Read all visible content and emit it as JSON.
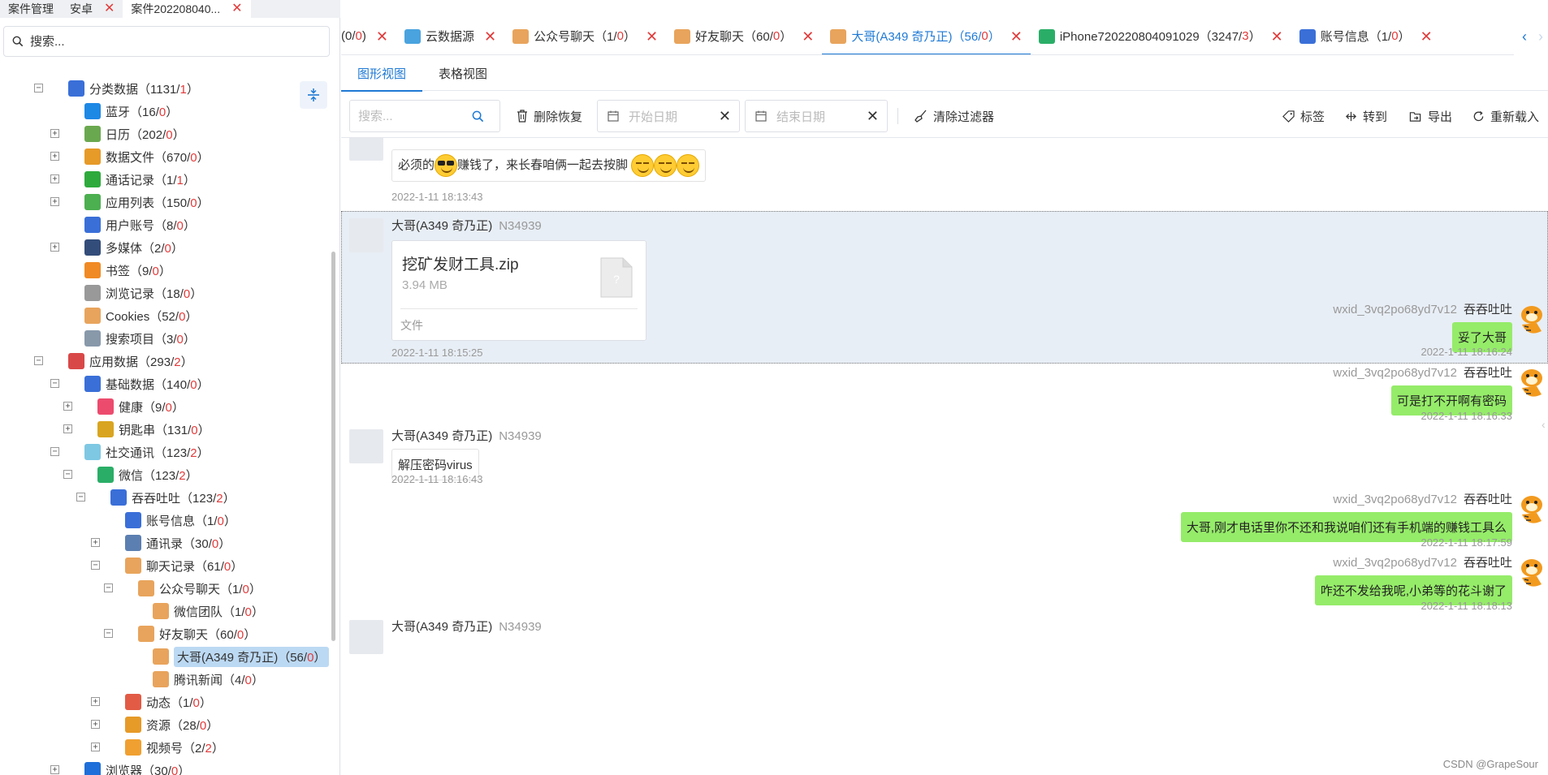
{
  "left_tabs": [
    {
      "label": "案件管理",
      "active": false
    },
    {
      "label": "安卓",
      "active": false
    },
    {
      "label": "案件202208040...",
      "active": true
    }
  ],
  "search": {
    "placeholder": "搜索..."
  },
  "tree": [
    {
      "label": "分类数据",
      "total": "1131",
      "red": "1",
      "icon": "classified-data-icon",
      "color": "#3a6fd8"
    },
    {
      "label": "蓝牙",
      "total": "16",
      "red": "0",
      "icon": "bluetooth-icon",
      "color": "#1e88e5"
    },
    {
      "label": "日历",
      "total": "202",
      "red": "0",
      "icon": "calendar-icon",
      "color": "#6aa84f"
    },
    {
      "label": "数据文件",
      "total": "670",
      "red": "0",
      "icon": "data-files-icon",
      "color": "#e69a28"
    },
    {
      "label": "通话记录",
      "total": "1",
      "red": "1",
      "icon": "phone-icon",
      "color": "#2eaa3c"
    },
    {
      "label": "应用列表",
      "total": "150",
      "red": "0",
      "icon": "app-list-icon",
      "color": "#4caf50"
    },
    {
      "label": "用户账号",
      "total": "8",
      "red": "0",
      "icon": "user-account-icon",
      "color": "#3a6fd8"
    },
    {
      "label": "多媒体",
      "total": "2",
      "red": "0",
      "icon": "multimedia-icon",
      "color": "#334d7a"
    },
    {
      "label": "书签",
      "total": "9",
      "red": "0",
      "icon": "bookmark-icon",
      "color": "#f08a24"
    },
    {
      "label": "浏览记录",
      "total": "18",
      "red": "0",
      "icon": "browse-history-icon",
      "color": "#999999"
    },
    {
      "label": "Cookies",
      "total": "52",
      "red": "0",
      "icon": "cookies-icon",
      "color": "#e8a45c"
    },
    {
      "label": "搜索项目",
      "total": "3",
      "red": "0",
      "icon": "search-items-icon",
      "color": "#8899aa"
    },
    {
      "label": "应用数据",
      "total": "293",
      "red": "2",
      "icon": "app-data-icon",
      "color": "#d94848"
    },
    {
      "label": "基础数据",
      "total": "140",
      "red": "0",
      "icon": "basic-data-icon",
      "color": "#3a6fd8"
    },
    {
      "label": "健康",
      "total": "9",
      "red": "0",
      "icon": "health-heart-icon",
      "color": "#ec4b6e"
    },
    {
      "label": "钥匙串",
      "total": "131",
      "red": "0",
      "icon": "keychain-icon",
      "color": "#d9a520"
    },
    {
      "label": "社交通讯",
      "total": "123",
      "red": "2",
      "icon": "social-comm-icon",
      "color": "#7ec8e3"
    },
    {
      "label": "微信",
      "total": "123",
      "red": "2",
      "icon": "wechat-icon",
      "color": "#2aae67"
    },
    {
      "label": "吞吞吐吐",
      "total": "123",
      "red": "2",
      "icon": "user-profile-icon",
      "color": "#3a6fd8"
    },
    {
      "label": "账号信息",
      "total": "1",
      "red": "0",
      "icon": "account-info-icon",
      "color": "#3a6fd8"
    },
    {
      "label": "通讯录",
      "total": "30",
      "red": "0",
      "icon": "contacts-icon",
      "color": "#5b7fb0"
    },
    {
      "label": "聊天记录",
      "total": "61",
      "red": "0",
      "icon": "chat-history-icon",
      "color": "#e8a45c"
    },
    {
      "label": "公众号聊天",
      "total": "1",
      "red": "0",
      "icon": "chat-bubble-icon",
      "color": "#e8a45c"
    },
    {
      "label": "微信团队",
      "total": "1",
      "red": "0",
      "icon": "chat-bubble-icon",
      "color": "#e8a45c"
    },
    {
      "label": "好友聊天",
      "total": "60",
      "red": "0",
      "icon": "chat-bubble-icon",
      "color": "#e8a45c"
    },
    {
      "label": "大哥(A349 奇乃正)",
      "total": "56",
      "red": "0",
      "icon": "chat-bubble-icon",
      "color": "#e8a45c"
    },
    {
      "label": "腾讯新闻",
      "total": "4",
      "red": "0",
      "icon": "chat-bubble-icon",
      "color": "#e8a45c"
    },
    {
      "label": "动态",
      "total": "1",
      "red": "0",
      "icon": "moments-icon",
      "color": "#e25b45"
    },
    {
      "label": "资源",
      "total": "28",
      "red": "0",
      "icon": "resources-icon",
      "color": "#e69a28"
    },
    {
      "label": "视频号",
      "total": "2",
      "red": "2",
      "icon": "video-channel-icon",
      "color": "#f0a030"
    },
    {
      "label": "浏览器",
      "total": "30",
      "red": "0",
      "icon": "browser-ie-icon",
      "color": "#1e6fd9"
    }
  ],
  "right_tabs": [
    {
      "label": "(0/",
      "red": "0",
      "tail": ")",
      "icon": "",
      "active": false
    },
    {
      "label": "云数据源",
      "red": "",
      "tail": "",
      "icon": "cloud-icon",
      "active": false
    },
    {
      "label": "公众号聊天（1/",
      "red": "0",
      "tail": "）",
      "icon": "chat-bubble-icon",
      "active": false
    },
    {
      "label": "好友聊天（60/",
      "red": "0",
      "tail": "）",
      "icon": "chat-bubble-icon",
      "active": false
    },
    {
      "label": "大哥(A349 奇乃正)（56/",
      "red": "0",
      "tail": "）",
      "icon": "chat-bubble-icon",
      "active": true
    },
    {
      "label": "iPhone720220804091029（3247/",
      "red": "3",
      "tail": "）",
      "icon": "phone-device-icon",
      "active": false
    },
    {
      "label": "账号信息（1/",
      "red": "0",
      "tail": "）",
      "icon": "account-info-icon",
      "active": false
    }
  ],
  "view_tabs": {
    "graphic": "图形视图",
    "table": "表格视图"
  },
  "toolbar": {
    "search_placeholder": "搜索...",
    "delete_restore": "删除恢复",
    "start_date": "开始日期",
    "end_date": "结束日期",
    "clear_filter": "清除过滤器",
    "tag": "标签",
    "goto": "转到",
    "export": "导出",
    "reload": "重新载入"
  },
  "messages": {
    "m1": {
      "text": "必须的",
      "text2": "赚钱了，来长春咱俩一起去按脚",
      "time": "2022-1-11 18:13:43"
    },
    "m2": {
      "name": "大哥(A349 奇乃正)",
      "id": "N34939",
      "file_name": "挖矿发财工具.zip",
      "file_size": "3.94 MB",
      "file_type": "文件",
      "time": "2022-1-11 18:15:25"
    },
    "m3": {
      "name": "吞吞吐吐",
      "id": "wxid_3vq2po68yd7v12",
      "text": "妥了大哥",
      "time": "2022-1-11 18:16:24"
    },
    "m4": {
      "name": "吞吞吐吐",
      "id": "wxid_3vq2po68yd7v12",
      "text": "可是打不开啊有密码",
      "time": "2022-1-11 18:16:33"
    },
    "m5": {
      "name": "大哥(A349 奇乃正)",
      "id": "N34939",
      "text": "解压密码virus",
      "time": "2022-1-11 18:16:43"
    },
    "m6": {
      "name": "吞吞吐吐",
      "id": "wxid_3vq2po68yd7v12",
      "text": "大哥,刚才电话里你不还和我说咱们还有手机端的赚钱工具么",
      "time": "2022-1-11 18:17:59"
    },
    "m7": {
      "name": "吞吞吐吐",
      "id": "wxid_3vq2po68yd7v12",
      "text": "咋还不发给我呢,小弟等的花斗谢了",
      "time": "2022-1-11 18:18:13"
    },
    "m8": {
      "name": "大哥(A349 奇乃正)",
      "id": "N34939"
    }
  },
  "watermark": "CSDN @GrapeSour",
  "colors": {
    "accent": "#1f7ad4",
    "red": "#e23a3a",
    "bubble_green": "#95ec69"
  }
}
